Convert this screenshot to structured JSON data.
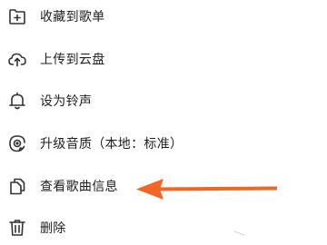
{
  "menu": {
    "items": [
      {
        "label": "收藏到歌单",
        "icon": "add-to-playlist-icon"
      },
      {
        "label": "上传到云盘",
        "icon": "cloud-upload-icon"
      },
      {
        "label": "设为铃声",
        "icon": "bell-icon"
      },
      {
        "label": "升级音质（本地：标准）",
        "icon": "audio-quality-icon"
      },
      {
        "label": "查看歌曲信息",
        "icon": "song-info-icon"
      },
      {
        "label": "删除",
        "icon": "trash-icon"
      }
    ]
  },
  "annotation": {
    "arrow_color": "#f26522",
    "points_to": "查看歌曲信息"
  },
  "colors": {
    "text": "#1f1f1f",
    "icon": "#333333",
    "background": "#ffffff"
  }
}
